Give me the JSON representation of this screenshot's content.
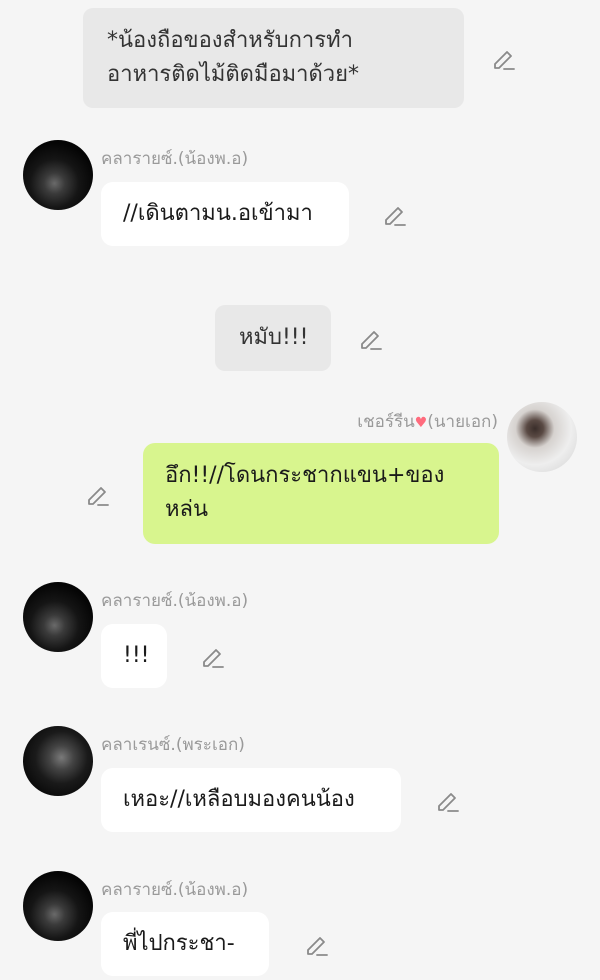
{
  "messages": [
    {
      "type": "narration",
      "text": "*น้องถือของสำหรับการทำอาหารติดไม้ติดมือมาด้วย*",
      "line1": "*น้องถือของสำหรับการทำ",
      "line2": "อาหารติดไม้ติดมือมาด้วย*"
    },
    {
      "type": "incoming",
      "sender": "คลารายซ์.(น้องพ.อ)",
      "text": "//เดินตามน.อเข้ามา"
    },
    {
      "type": "narration",
      "text": "หมับ!!!"
    },
    {
      "type": "outgoing",
      "sender": "เชอร์รีน",
      "sender_suffix": "(นายเอก)",
      "text": "อึก!!//โดนกระชากแขน+ของหล่น",
      "line1": "อึก!!//โดนกระชากแขน+ของ",
      "line2": "หล่น"
    },
    {
      "type": "incoming",
      "sender": "คลารายซ์.(น้องพ.อ)",
      "text": "!!!"
    },
    {
      "type": "incoming",
      "sender": "คลาเรนซ์.(พระเอก)",
      "text": "เหอะ//เหลือบมองคนน้อง"
    },
    {
      "type": "incoming",
      "sender": "คลารายซ์.(น้องพ.อ)",
      "text": "พี่ไปกระชา-"
    }
  ],
  "icons": {
    "edit": "pencil-edit-icon",
    "sender_emoji": "heart-icon"
  },
  "colors": {
    "background": "#f5f5f5",
    "narration_bubble": "#e8e8e8",
    "incoming_bubble": "#ffffff",
    "outgoing_bubble": "#d8f58e",
    "sender_name": "#9a9a9a"
  }
}
